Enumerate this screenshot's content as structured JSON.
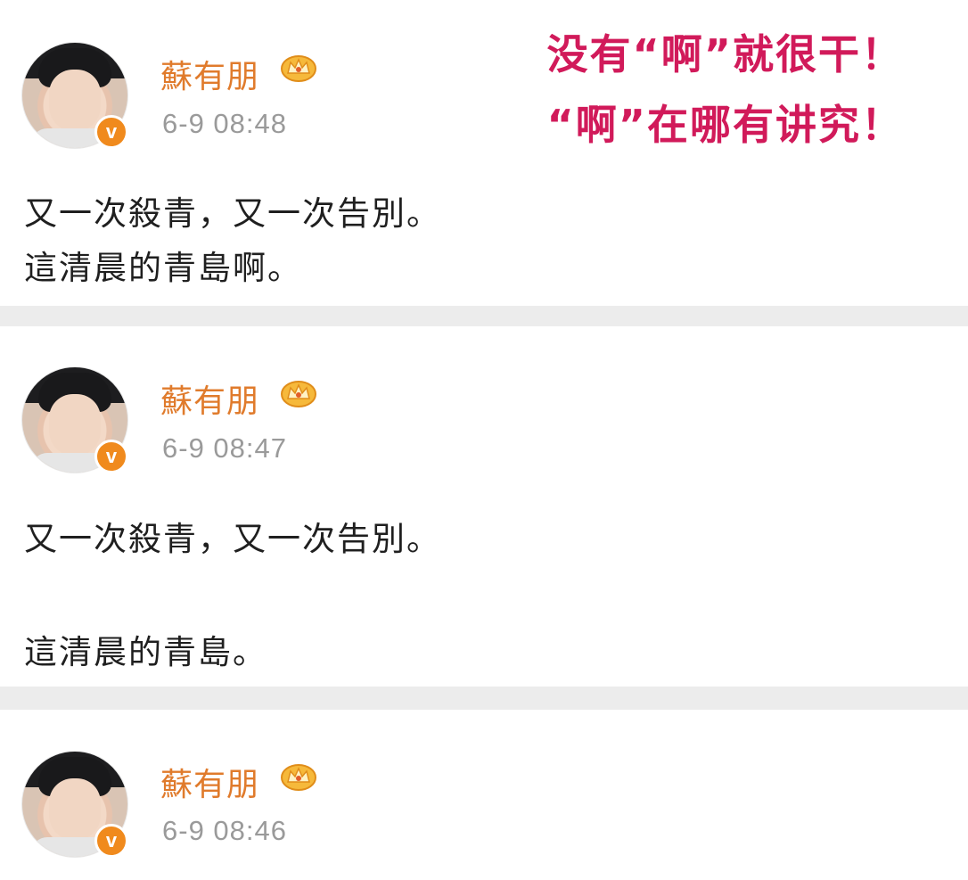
{
  "annotation": {
    "line_1": "没有“啊”就很干！",
    "line_2": "“啊”在哪有讲究！",
    "color": "#d11a5a"
  },
  "posts": [
    {
      "username": "蘇有朋",
      "timestamp": "6-9 08:48",
      "lines": [
        "又一次殺青，又一次告別。",
        "這清晨的青島啊。"
      ]
    },
    {
      "username": "蘇有朋",
      "timestamp": "6-9 08:47",
      "lines": [
        "又一次殺青，又一次告別。",
        "這清晨的青島。"
      ]
    },
    {
      "username": "蘇有朋",
      "timestamp": "6-9 08:46",
      "lines": []
    }
  ],
  "icons": {
    "verified_badge": "v-badge-icon",
    "crown": "crown-icon"
  },
  "badge_text": "v",
  "colors": {
    "username": "#e07b2c",
    "timestamp": "#9a9a9a",
    "body_text": "#1f1f1f",
    "divider": "#ececec",
    "badge": "#f08a1d"
  }
}
